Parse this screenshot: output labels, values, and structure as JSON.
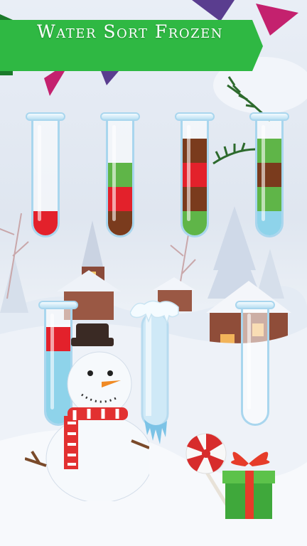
{
  "game": {
    "title": "Water Sort Frozen"
  },
  "colors": {
    "red": "#e3212b",
    "brown": "#7a3b1d",
    "green": "#5fb548",
    "light_blue": "#8ed3ea",
    "banner_green": "#2fb843",
    "pennant_magenta": "#c4216e",
    "pennant_purple": "#5a3d8f"
  },
  "tubes": [
    {
      "id": "tube-1",
      "layers": [
        "red"
      ]
    },
    {
      "id": "tube-2",
      "layers": [
        "brown",
        "red",
        "green"
      ]
    },
    {
      "id": "tube-3",
      "layers": [
        "green",
        "brown",
        "red",
        "brown"
      ]
    },
    {
      "id": "tube-4",
      "layers": [
        "light_blue",
        "green",
        "brown",
        "green"
      ]
    },
    {
      "id": "tube-5",
      "layers": [
        "light_blue",
        "light_blue",
        "light_blue",
        "red"
      ]
    },
    {
      "id": "tube-6",
      "frozen": true,
      "layers": [
        "light_blue",
        "light_blue",
        "light_blue",
        "light_blue"
      ]
    },
    {
      "id": "tube-7",
      "layers": []
    }
  ],
  "icons": [
    "pennant-flag-icon",
    "snowman-icon",
    "candy-lollipop-icon",
    "gift-box-icon",
    "house-icon",
    "church-icon",
    "pine-branch-icon"
  ]
}
